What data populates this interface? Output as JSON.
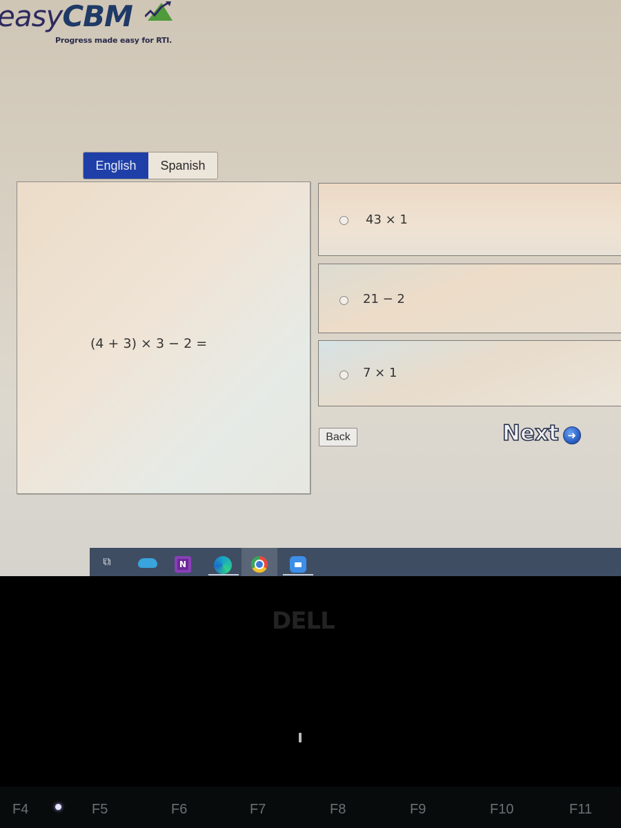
{
  "app": {
    "logo": {
      "prefix": "easy",
      "brand": "CBM",
      "tagline": "Progress made easy for RTI."
    }
  },
  "language_tabs": [
    {
      "label": "English",
      "active": true
    },
    {
      "label": "Spanish",
      "active": false
    }
  ],
  "question": {
    "text": "(4 + 3) × 3 − 2 ="
  },
  "options": [
    {
      "label": "43 × 1",
      "selected": false
    },
    {
      "label": "21 − 2",
      "selected": false
    },
    {
      "label": "7 × 1",
      "selected": false
    }
  ],
  "navigation": {
    "back_label": "Back",
    "next_label": "Next",
    "next_icon": "arrow-right-circle-icon"
  },
  "taskbar": {
    "icons": [
      "task-view-icon",
      "onedrive-icon",
      "onenote-icon",
      "edge-icon",
      "chrome-icon",
      "zoom-icon"
    ],
    "onenote_letter": "N"
  },
  "device": {
    "brand": "DELL",
    "function_keys": [
      "F4",
      "F5",
      "F6",
      "F7",
      "F8",
      "F9",
      "F10",
      "F11"
    ]
  },
  "colors": {
    "active_tab": "#1f3fa8",
    "logo_text": "#1f3a66",
    "taskbar": "#3f4d63"
  }
}
